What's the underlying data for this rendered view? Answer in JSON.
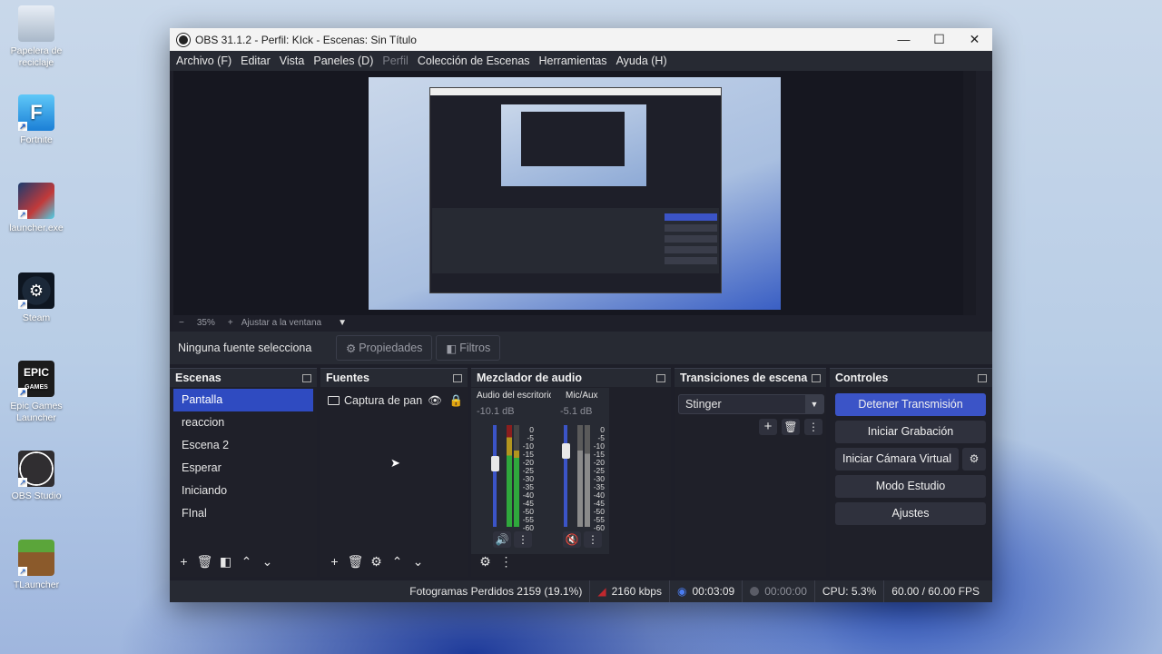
{
  "desktop": {
    "icons": [
      {
        "label": "Papelera de reciclaje",
        "icon": "recycle-bin-icon"
      },
      {
        "label": "Fortnite",
        "icon": "fortnite-icon"
      },
      {
        "label": "launcher.exe",
        "icon": "launcher-icon"
      },
      {
        "label": "Steam",
        "icon": "steam-icon"
      },
      {
        "label": "Epic Games Launcher",
        "icon": "epic-games-icon"
      },
      {
        "label": "OBS Studio",
        "icon": "obs-icon"
      },
      {
        "label": "TLauncher",
        "icon": "minecraft-icon"
      }
    ]
  },
  "window": {
    "title": "OBS 31.1.2 - Perfil: KIck - Escenas: Sin Título",
    "minimize": "—",
    "maximize": "☐",
    "close": "✕"
  },
  "menu": {
    "items": [
      "Archivo (F)",
      "Editar",
      "Vista",
      "Paneles (D)",
      "Perfil",
      "Colección de Escenas",
      "Herramientas",
      "Ayuda (H)"
    ]
  },
  "preview": {
    "zoom_minus": "−",
    "zoom": "35%",
    "zoom_plus": "+",
    "fit_label": "Ajustar a la ventana",
    "fit_caret": "▼"
  },
  "source_toolbar": {
    "no_source": "Ninguna fuente selecciona",
    "properties": "Propiedades",
    "filters": "Filtros"
  },
  "scenes": {
    "title": "Escenas",
    "items": [
      "Pantalla",
      "reaccion",
      "Escena 2",
      "Esperar",
      "Iniciando",
      "FInal"
    ],
    "selected": 0
  },
  "sources": {
    "title": "Fuentes",
    "items": [
      {
        "label": "Captura de pantalla"
      }
    ]
  },
  "mixer": {
    "title": "Mezclador de audio",
    "channels": [
      {
        "name": "Audio del escritorio",
        "db": "-10.1 dB",
        "fader_level": 0.45,
        "muted": false
      },
      {
        "name": "Mic/Aux",
        "db": "-5.1 dB",
        "fader_level": 0.62,
        "muted": true
      }
    ],
    "scale": [
      "0",
      "-5",
      "-10",
      "-15",
      "-20",
      "-25",
      "-30",
      "-35",
      "-40",
      "-45",
      "-50",
      "-55",
      "-60"
    ]
  },
  "transitions": {
    "title": "Transiciones de escena",
    "selected": "Stinger"
  },
  "controls": {
    "title": "Controles",
    "stop_stream": "Detener Transmisión",
    "start_recording": "Iniciar Grabación",
    "start_virtualcam": "Iniciar Cámara Virtual",
    "studio_mode": "Modo Estudio",
    "settings": "Ajustes",
    "accent": "#3b54c7"
  },
  "status": {
    "dropped": "Fotogramas Perdidos 2159 (19.1%)",
    "bitrate": "2160 kbps",
    "stream_time": "00:03:09",
    "record_time": "00:00:00",
    "cpu": "CPU: 5.3%",
    "fps": "60.00 / 60.00 FPS"
  }
}
